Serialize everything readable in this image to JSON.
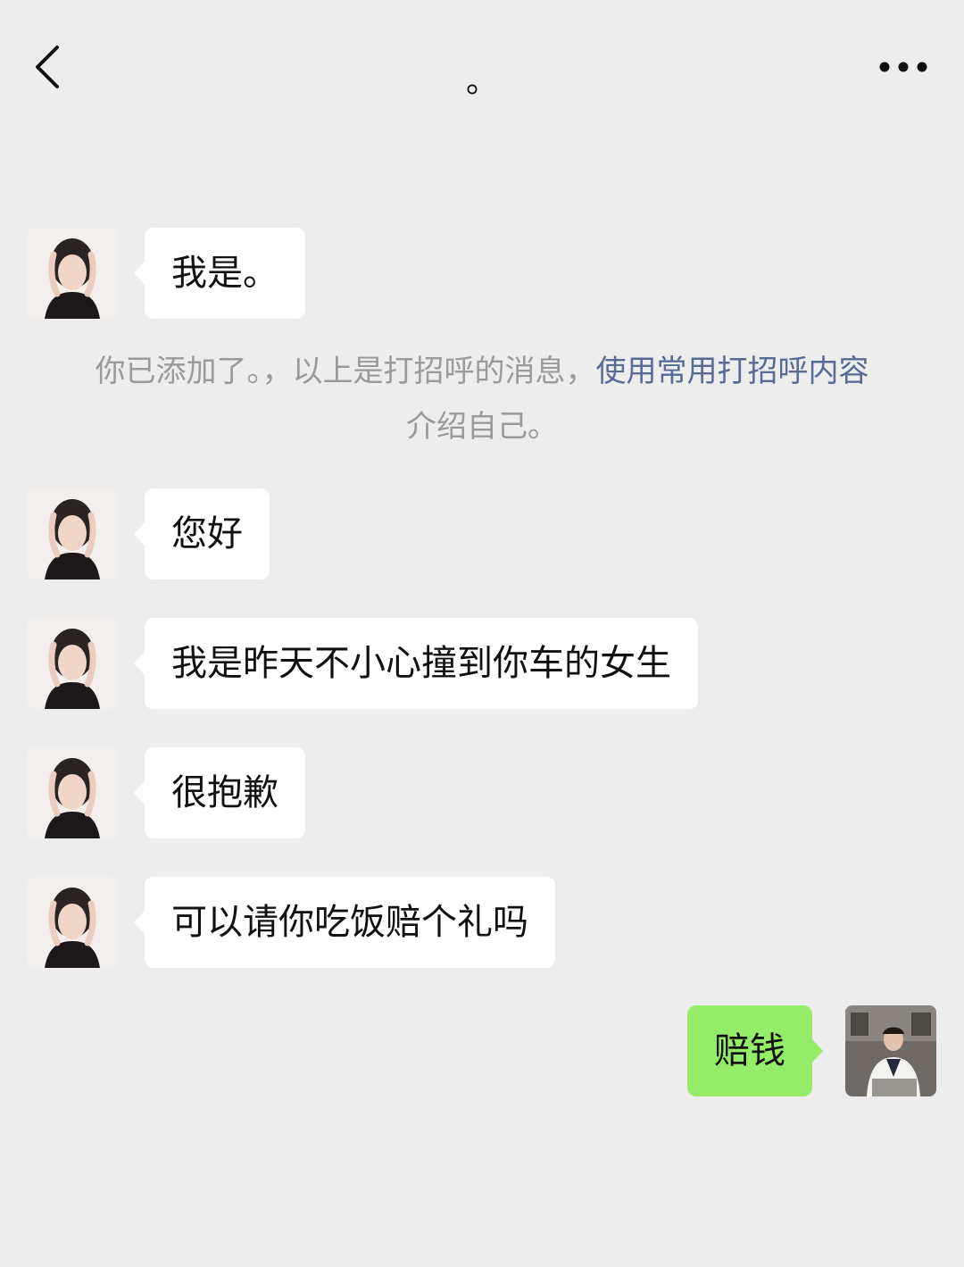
{
  "header": {
    "title": "。",
    "back_icon": "chevron-left-icon",
    "more_icon": "more-dots-icon"
  },
  "system_note": {
    "text_before": "你已添加了。，以上是打招呼的消息，",
    "link_text": "使用常用打招呼内容",
    "text_after": "介绍自己。"
  },
  "messages": [
    {
      "from": "contact",
      "text": "我是。"
    },
    {
      "from": "contact",
      "text": "您好"
    },
    {
      "from": "contact",
      "text": "我是昨天不小心撞到你车的女生"
    },
    {
      "from": "contact",
      "text": "很抱歉"
    },
    {
      "from": "contact",
      "text": "可以请你吃饭赔个礼吗"
    },
    {
      "from": "me",
      "text": "赔钱"
    }
  ],
  "colors": {
    "background": "#ededed",
    "incoming_bubble": "#ffffff",
    "outgoing_bubble": "#95ec69",
    "link": "#576b95",
    "system_text": "#9a9a9a"
  }
}
